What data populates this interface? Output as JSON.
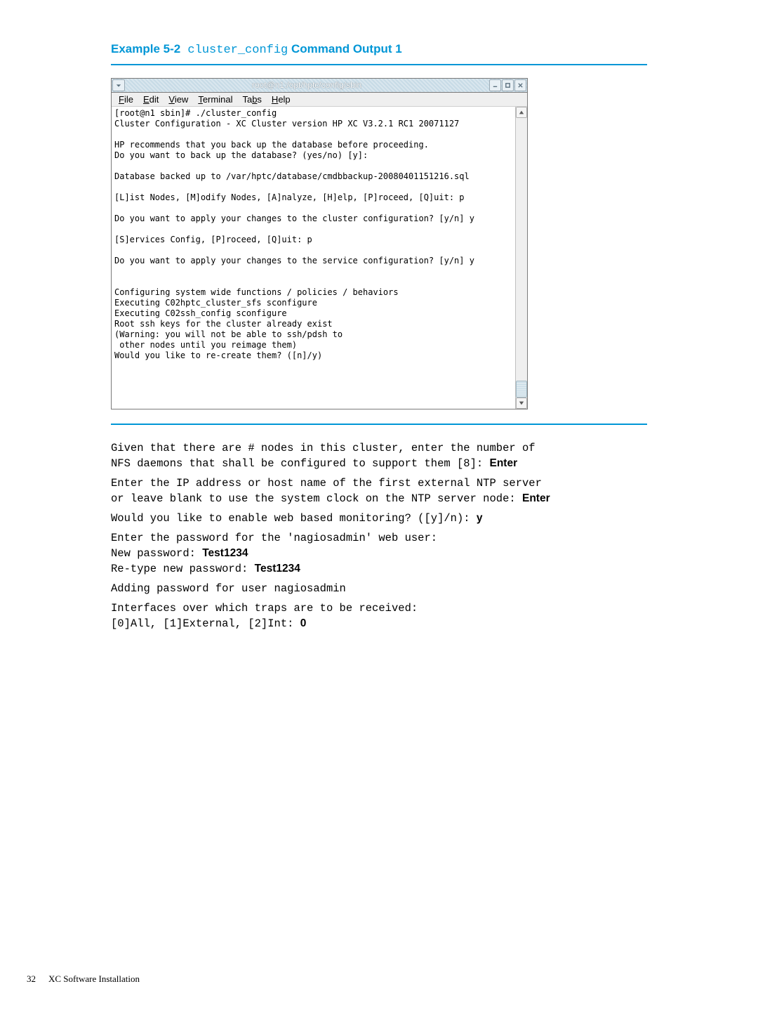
{
  "example_title": {
    "prefix": "Example 5-2",
    "cmd": " cluster_config",
    "suffix": " Command Output 1"
  },
  "terminal": {
    "title": "root@n1:/opt/hptc/config/sbin",
    "menu": [
      "File",
      "Edit",
      "View",
      "Terminal",
      "Tabs",
      "Help"
    ],
    "menu_keys": [
      "F",
      "E",
      "V",
      "T",
      "b",
      "H"
    ],
    "content": "[root@n1 sbin]# ./cluster_config\nCluster Configuration - XC Cluster version HP XC V3.2.1 RC1 20071127\n\nHP recommends that you back up the database before proceeding.\nDo you want to back up the database? (yes/no) [y]:\n\nDatabase backed up to /var/hptc/database/cmdbbackup-20080401151216.sql\n\n[L]ist Nodes, [M]odify Nodes, [A]nalyze, [H]elp, [P]roceed, [Q]uit: p\n\nDo you want to apply your changes to the cluster configuration? [y/n] y\n\n[S]ervices Config, [P]roceed, [Q]uit: p\n\nDo you want to apply your changes to the service configuration? [y/n] y\n\n\nConfiguring system wide functions / policies / behaviors\nExecuting C02hptc_cluster_sfs sconfigure\nExecuting C02ssh_config sconfigure\nRoot ssh keys for the cluster already exist\n(Warning: you will not be able to ssh/pdsh to\n other nodes until you reimage them)\nWould you like to re-create them? ([n]/y)"
  },
  "body_lines": [
    {
      "text": "Given that there are # nodes in this cluster, enter the number of"
    },
    {
      "text": "NFS daemons that shall be configured to support them [8]: ",
      "bold_suffix": "Enter"
    },
    {
      "text": "Enter the IP address or host name of the first external NTP server"
    },
    {
      "text": "or leave blank to use the system clock on the NTP server node: ",
      "bold_suffix": "Enter"
    },
    {
      "text": "Would you like to enable web based monitoring? ([y]/n): ",
      "bold_suffix": "y"
    },
    {
      "text": "Enter the password for the 'nagiosadmin' web user:"
    },
    {
      "text": "New password: ",
      "bold_suffix": "Test1234"
    },
    {
      "text": "Re-type new password: ",
      "bold_suffix": "Test1234"
    },
    {
      "text": "Adding password for user nagiosadmin"
    },
    {
      "text": "Interfaces over which traps are to be received:"
    },
    {
      "text": "[0]All, [1]External, [2]Int: ",
      "bold_suffix": "0"
    }
  ],
  "footer": {
    "page": "32",
    "title": "XC Software Installation"
  },
  "menu_render": [
    {
      "pre": "",
      "u": "F",
      "post": "ile"
    },
    {
      "pre": "",
      "u": "E",
      "post": "dit"
    },
    {
      "pre": "",
      "u": "V",
      "post": "iew"
    },
    {
      "pre": "",
      "u": "T",
      "post": "erminal"
    },
    {
      "pre": "Ta",
      "u": "b",
      "post": "s"
    },
    {
      "pre": "",
      "u": "H",
      "post": "elp"
    }
  ]
}
